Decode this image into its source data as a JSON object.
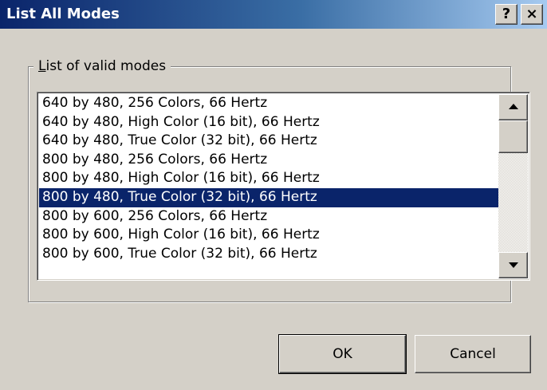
{
  "window": {
    "title": "List All Modes",
    "help_label": "?",
    "close_label": "×"
  },
  "group": {
    "label_mnemonic": "L",
    "label_rest": "ist of valid modes"
  },
  "modes": [
    "640 by 480, 256 Colors, 66 Hertz",
    "640 by 480, High Color (16 bit), 66 Hertz",
    "640 by 480, True Color (32 bit), 66 Hertz",
    "800 by 480, 256 Colors, 66 Hertz",
    "800 by 480, High Color (16 bit), 66 Hertz",
    "800 by 480, True Color (32 bit), 66 Hertz",
    "800 by 600, 256 Colors, 66 Hertz",
    "800 by 600, High Color (16 bit), 66 Hertz",
    "800 by 600, True Color (32 bit), 66 Hertz"
  ],
  "selected_mode": "800 by 480, True Color (32 bit), 66 Hertz",
  "buttons": {
    "ok_label": "OK",
    "cancel_label": "Cancel"
  },
  "colors": {
    "title_bar": "#0a246a",
    "selection": "#0a246a",
    "face": "#d4d0c8"
  },
  "icons": {
    "scroll_up": "up-arrow-icon",
    "scroll_down": "down-arrow-icon"
  }
}
